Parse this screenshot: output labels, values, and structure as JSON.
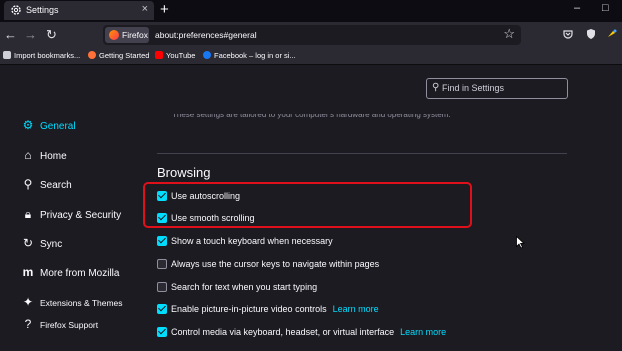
{
  "tab": {
    "title": "Settings",
    "close": "×",
    "new_tab": "+"
  },
  "window": {
    "minimize": "–",
    "maximize": "□"
  },
  "urlbar": {
    "identity_label": "Firefox",
    "url": "about:preferences#general"
  },
  "bookmarks": [
    {
      "label": "Import bookmarks...",
      "color": "#cfcfd8"
    },
    {
      "label": "Getting Started",
      "color": "#ff7139"
    },
    {
      "label": "YouTube",
      "color": "#ff0000"
    },
    {
      "label": "Facebook – log in or si...",
      "color": "#1877f2"
    }
  ],
  "search": {
    "placeholder": "Find in Settings"
  },
  "sidebar": [
    {
      "label": "General",
      "icon": "gear-icon",
      "selected": true
    },
    {
      "label": "Home",
      "icon": "home-icon"
    },
    {
      "label": "Search",
      "icon": "search-icon"
    },
    {
      "label": "Privacy & Security",
      "icon": "lock-icon"
    },
    {
      "label": "Sync",
      "icon": "sync-icon"
    },
    {
      "label": "More from Mozilla",
      "icon": "mozilla-icon"
    },
    {
      "label": "Extensions & Themes",
      "icon": "puzzle-icon"
    },
    {
      "label": "Firefox Support",
      "icon": "help-icon"
    }
  ],
  "faded_text": "These settings are tailored to your computer's hardware and operating system.",
  "browsing": {
    "heading": "Browsing",
    "options": [
      {
        "label": "Use autoscrolling",
        "checked": true
      },
      {
        "label": "Use smooth scrolling",
        "checked": true
      },
      {
        "label": "Show a touch keyboard when necessary",
        "checked": true
      },
      {
        "label": "Always use the cursor keys to navigate within pages",
        "checked": false
      },
      {
        "label": "Search for text when you start typing",
        "checked": false
      },
      {
        "label": "Enable picture-in-picture video controls",
        "checked": true,
        "link": "Learn more"
      },
      {
        "label": "Control media via keyboard, headset, or virtual interface",
        "checked": true,
        "link": "Learn more"
      }
    ]
  },
  "colors": {
    "accent": "#00ddff",
    "highlight": "#e0101b",
    "background": "#1c1b22"
  }
}
